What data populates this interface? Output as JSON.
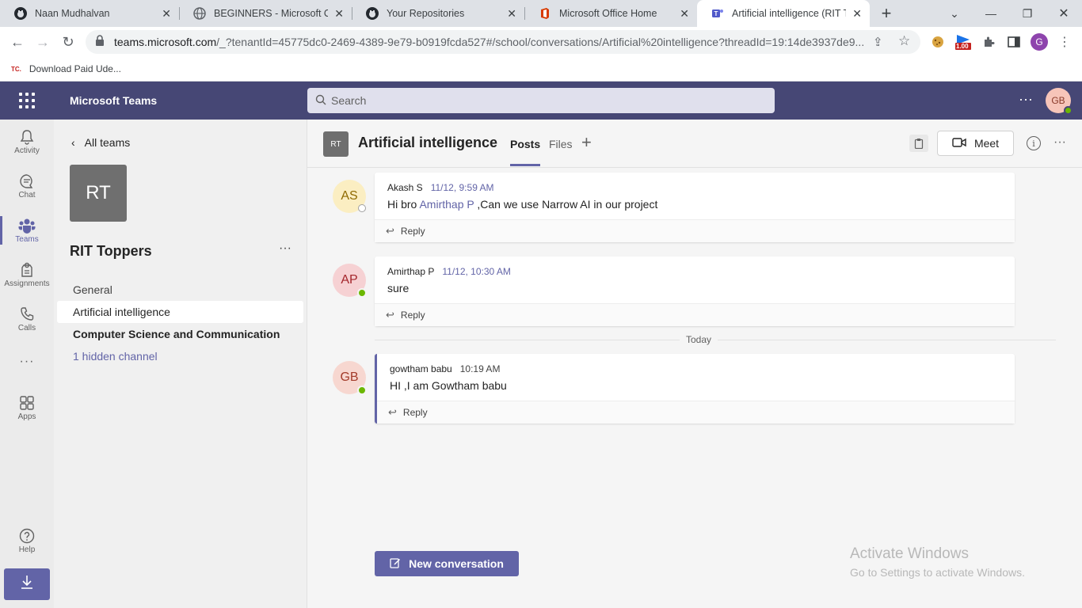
{
  "browser": {
    "tabs": [
      {
        "label": "Naan Mudhalvan",
        "icon": "github-icon"
      },
      {
        "label": "BEGINNERS - Microsoft Offic",
        "icon": "globe-icon"
      },
      {
        "label": "Your Repositories",
        "icon": "github-icon"
      },
      {
        "label": "Microsoft Office Home",
        "icon": "office-icon"
      },
      {
        "label": "Artificial intelligence (RIT Top",
        "icon": "teams-icon"
      }
    ],
    "url_main": "teams.microsoft.com",
    "url_rest": "/_?tenantId=45775dc0-2469-4389-9e79-b0919fcda527#/school/conversations/Artificial%20intelligence?threadId=19:14de3937de9...",
    "extension_badge": "1.00",
    "profile_initial": "G",
    "bookmark_icon": "TC.",
    "bookmark": "Download Paid Ude..."
  },
  "teams": {
    "app_title": "Microsoft Teams",
    "search_placeholder": "Search",
    "user_initials": "GB",
    "accent": "#6264a7",
    "header_color": "#464775"
  },
  "rail": {
    "items": [
      {
        "label": "Activity",
        "icon": "bell-icon"
      },
      {
        "label": "Chat",
        "icon": "chat-icon"
      },
      {
        "label": "Teams",
        "icon": "teams-icon"
      },
      {
        "label": "Assignments",
        "icon": "assignments-icon"
      },
      {
        "label": "Calls",
        "icon": "phone-icon"
      },
      {
        "label": "",
        "icon": "more-icon"
      },
      {
        "label": "Apps",
        "icon": "apps-icon"
      },
      {
        "label": "Help",
        "icon": "help-icon"
      }
    ]
  },
  "teampane": {
    "back_label": "All teams",
    "team_initials": "RT",
    "team_name": "RIT Toppers",
    "channels": [
      {
        "label": "General"
      },
      {
        "label": "Artificial intelligence"
      },
      {
        "label": "Computer Science and Communication"
      },
      {
        "label": "1 hidden channel"
      }
    ]
  },
  "channel": {
    "initials": "RT",
    "title": "Artificial intelligence",
    "tabs": [
      "Posts",
      "Files"
    ],
    "meet_label": "Meet"
  },
  "posts": [
    {
      "initials": "AS",
      "author": "Akash S",
      "time": "11/12, 9:59 AM",
      "text_pre": "Hi bro ",
      "mention": "Amirthap P",
      "text_post": " ,Can we use Narrow AI in our project",
      "reply": "Reply",
      "avatar_bg": "#fbeec2",
      "avatar_fg": "#8f6a00",
      "presence": "away"
    },
    {
      "initials": "AP",
      "author": "Amirthap P",
      "time": "11/12, 10:30 AM",
      "text_pre": "sure",
      "mention": "",
      "text_post": "",
      "reply": "Reply",
      "avatar_bg": "#f6d1d3",
      "avatar_fg": "#a4262c",
      "presence": "available"
    },
    {
      "initials": "GB",
      "author": "gowtham babu",
      "time": "10:19 AM",
      "text_pre": "HI ,I am Gowtham babu",
      "mention": "",
      "text_post": "",
      "reply": "Reply",
      "avatar_bg": "#f7d7d0",
      "avatar_fg": "#a33b2a",
      "presence": "available"
    }
  ],
  "divider_label": "Today",
  "new_conversation": "New conversation",
  "watermark": {
    "title": "Activate Windows",
    "subtitle": "Go to Settings to activate Windows."
  }
}
